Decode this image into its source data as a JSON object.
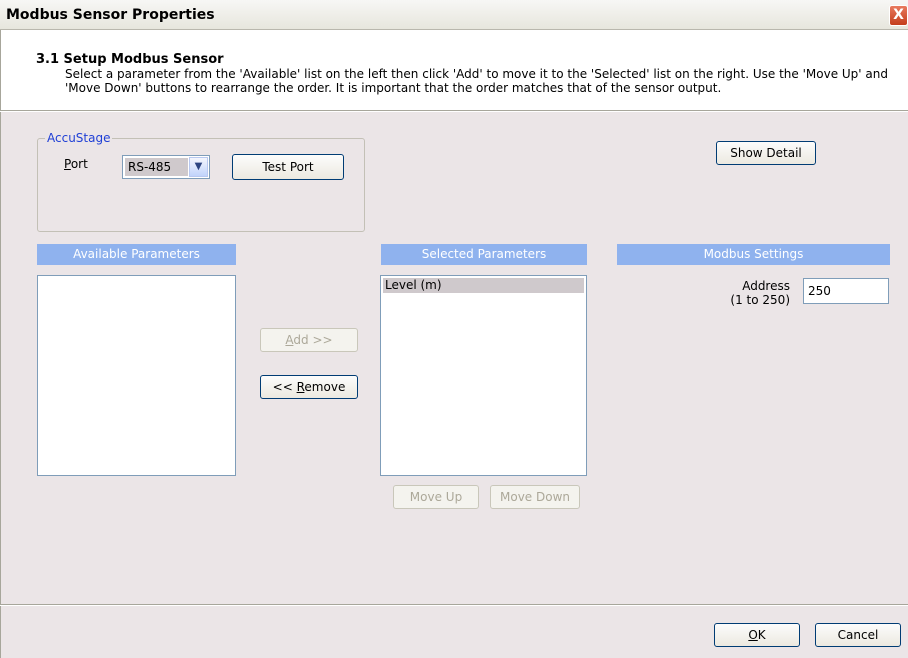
{
  "window": {
    "title": "Modbus Sensor Properties",
    "close_label": "X"
  },
  "header": {
    "title": "3.1 Setup Modbus Sensor",
    "description": "Select a parameter from the 'Available' list on the left then click 'Add' to move it to the 'Selected' list on the right.  Use the 'Move Up' and 'Move Down' buttons to rearrange the order.  It is important that the order matches that of the sensor output."
  },
  "accustage": {
    "group_title": "AccuStage",
    "port_label_underlined": "P",
    "port_label_rest": "ort",
    "port_value": "RS-485",
    "test_port_label": "Test Port"
  },
  "show_detail_label": "Show Detail",
  "available": {
    "header": "Available Parameters",
    "items": []
  },
  "buttons": {
    "add_underlined": "A",
    "add_rest": "dd >>",
    "remove_prefix": "<< ",
    "remove_underlined": "R",
    "remove_rest": "emove",
    "move_up": "Move Up",
    "move_down": "Move Down",
    "ok_underlined": "O",
    "ok_rest": "K",
    "cancel": "Cancel"
  },
  "selected": {
    "header": "Selected Parameters",
    "items": [
      "Level (m)"
    ]
  },
  "modbus": {
    "header": "Modbus Settings",
    "address_label": "Address",
    "address_range": "(1 to 250)",
    "address_value": "250"
  },
  "colors": {
    "panel_header": "#8fb2ee",
    "body_bg": "#ebe5e7",
    "group_title": "#1f3fd6"
  }
}
